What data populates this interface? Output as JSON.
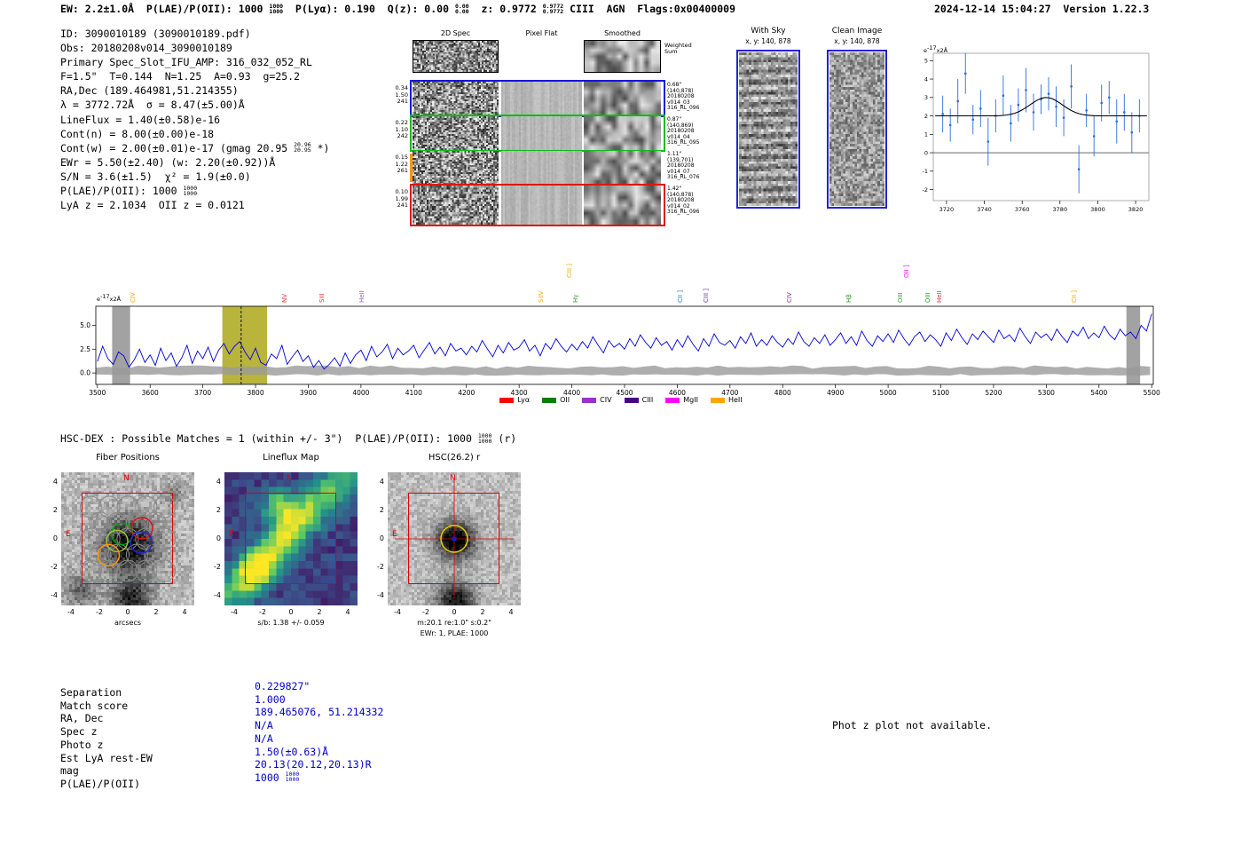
{
  "header": {
    "left_segments": [
      {
        "t": "EW: 2.2±1.0Å  P(LAE)/P(OII): 1000 ",
        "hi": "1000",
        "lo": "1000"
      },
      {
        "t": "  P(Lyα): 0.190  Q(z): 0.00 ",
        "hi": "0.00",
        "lo": "0.00"
      },
      {
        "t": "  z: 0.9772 ",
        "hi": "0.9772",
        "lo": "0.9772"
      },
      {
        "t": " CIII  AGN  Flags:0x00400009"
      }
    ],
    "datetime": "2024-12-14 15:04:27",
    "version": "Version 1.22.3"
  },
  "info_block": {
    "lines": [
      [
        {
          "t": "ID: 3090010189 (3090010189.pdf)"
        }
      ],
      [
        {
          "t": "Obs: 20180208v014_3090010189"
        }
      ],
      [
        {
          "t": "Primary Spec_Slot_IFU_AMP: 316_032_052_RL"
        }
      ],
      [
        {
          "t": "F=1.5\"  T=0.144  N=1.25  A=0.93  g=25.2"
        }
      ],
      [
        {
          "t": "RA,Dec (189.464981,51.214355)"
        }
      ],
      [
        {
          "t": "λ = 3772.72Å  σ = 8.47(±5.00)Å"
        }
      ],
      [
        {
          "t": "LineFlux = 1.40(±0.58)e-16"
        }
      ],
      [
        {
          "t": "Cont(n) = 8.00(±0.00)e-18"
        }
      ],
      [
        {
          "t": "Cont(w) = 2.00(±0.01)e-17 (gmag 20.95 ",
          "hi": "20.96",
          "lo": "20.95"
        },
        {
          "t": " *)"
        }
      ],
      [
        {
          "t": "EWr = 5.50(±2.40) (w: 2.20(±0.92))Å"
        }
      ],
      [
        {
          "t": "S/N = 3.6(±1.5)  χ² = 1.9(±0.0)"
        }
      ],
      [
        {
          "t": "P(LAE)/P(OII): 1000 ",
          "hi": "1000",
          "lo": "1000"
        }
      ],
      [
        {
          "t": "LyA z = 2.1034  OII z = 0.0121"
        }
      ]
    ]
  },
  "spec2d": {
    "col_headers": [
      "2D Spec",
      "Pixel Flat",
      "Smoothed"
    ],
    "weighted_sum": [
      "Weighted",
      "Sum"
    ],
    "rows": [
      {
        "left": [
          "0.34",
          "1.50",
          "241"
        ],
        "right": [
          "0.68\"",
          "(140,878)",
          "20180208",
          "v014_03",
          "316_RL_096"
        ],
        "border": "#1515e0"
      },
      {
        "left": [
          "0.22",
          "1.10",
          "242"
        ],
        "right": [
          "0.87\"",
          "(140,869)",
          "20180208",
          "v014_04",
          "316_RL_095"
        ],
        "border": "#11bb11"
      },
      {
        "left": [
          "0.15",
          "1.22",
          "261"
        ],
        "right": [
          "1.11\"",
          "(139,701)",
          "20180208",
          "v014_07",
          "316_RL_076"
        ],
        "border": "none",
        "left_tick": "#ff9900"
      },
      {
        "left": [
          "0.10",
          "1.99",
          "241"
        ],
        "right": [
          "1.42\"",
          "(140,878)",
          "20180208",
          "v014_02",
          "316_RL_096"
        ],
        "border": "#e01515"
      }
    ]
  },
  "sky_panels": [
    {
      "title": "With Sky",
      "subtitle": "x, y: 140, 878"
    },
    {
      "title": "Clean Image",
      "subtitle": "x, y: 140, 878"
    }
  ],
  "hsc_header": [
    {
      "t": "HSC-DEX : Possible Matches = 1 (within +/- 3\")  P(LAE)/P(OII): 1000 ",
      "hi": "1000",
      "lo": "1000"
    },
    {
      "t": " (r)"
    }
  ],
  "cutout_panels": {
    "titles": [
      "Fiber Positions",
      "Lineflux Map",
      "HSC(26.2) r"
    ],
    "xticks": [
      -4,
      -2,
      0,
      2,
      4
    ],
    "yticks": [
      4,
      2,
      0,
      -2,
      -4
    ],
    "xlabels": [
      "arcsecs",
      "s/b: 1.38 +/- 0.059",
      "m:20.1 re:1.0\" s:0.2\""
    ],
    "extra_label": "EWr: 1, PLAE: 1000",
    "compass_n": "N",
    "compass_e": "E",
    "accent_color": "#e00000"
  },
  "match_table": {
    "value_color": "#0000cd",
    "rows": [
      {
        "label": "Separation",
        "value": [
          {
            "t": "0.229827\""
          }
        ]
      },
      {
        "label": "Match score",
        "value": [
          {
            "t": "1.000"
          }
        ]
      },
      {
        "label": "RA, Dec",
        "value": [
          {
            "t": "189.465076, 51.214332"
          }
        ]
      },
      {
        "label": "Spec z",
        "value": [
          {
            "t": "N/A"
          }
        ]
      },
      {
        "label": "Photo z",
        "value": [
          {
            "t": "N/A"
          }
        ]
      },
      {
        "label": "Est LyA rest-EW",
        "value": [
          {
            "t": "1.50(±0.63)Å"
          }
        ]
      },
      {
        "label": "mag",
        "value": [
          {
            "t": "20.13(20.12,20.13)R"
          }
        ]
      },
      {
        "label": "P(LAE)/P(OII)",
        "value": [
          {
            "t": "1000 ",
            "hi": "1000",
            "lo": "1000"
          }
        ]
      }
    ]
  },
  "phot_z_note": "Phot z plot not available.",
  "chart_data": [
    {
      "id": "line_fit_plot",
      "type": "scatter",
      "annotation": [
        {
          "t": "e",
          "hi": "-17"
        },
        {
          "t": "x2Å"
        }
      ],
      "xlim": [
        3713,
        3827
      ],
      "ylim": [
        -2.6,
        5.4
      ],
      "xticks": [
        3720,
        3740,
        3760,
        3780,
        3800,
        3820
      ],
      "yticks": [
        5,
        4,
        3,
        2,
        1,
        0,
        -1,
        -2
      ],
      "points_x": [
        3718,
        3722,
        3726,
        3730,
        3734,
        3738,
        3742,
        3746,
        3750,
        3754,
        3758,
        3762,
        3766,
        3770,
        3774,
        3778,
        3782,
        3786,
        3790,
        3794,
        3798,
        3802,
        3806,
        3810,
        3814,
        3818,
        3822
      ],
      "points_y": [
        2.1,
        1.5,
        2.8,
        4.3,
        1.8,
        2.4,
        0.6,
        2.0,
        3.1,
        1.6,
        2.6,
        3.4,
        2.2,
        2.9,
        3.2,
        2.5,
        1.9,
        3.6,
        -0.9,
        2.3,
        0.9,
        2.7,
        3.0,
        1.7,
        2.2,
        1.1,
        2.0
      ],
      "points_yerr": [
        1.0,
        0.9,
        1.2,
        1.1,
        0.8,
        1.0,
        1.3,
        0.9,
        1.1,
        1.0,
        0.9,
        1.2,
        1.0,
        0.8,
        0.9,
        1.1,
        1.0,
        1.2,
        1.3,
        0.9,
        1.1,
        1.0,
        0.9,
        1.2,
        1.0,
        1.1,
        0.9
      ],
      "fit": {
        "shape": "gaussian",
        "center": 3772.72,
        "sigma": 8.47,
        "amplitude": 1.0,
        "continuum": 2.0
      },
      "point_color": "#2a6fdb",
      "fit_color": "#000000"
    },
    {
      "id": "full_spectrum",
      "type": "line",
      "ylabel": [
        {
          "t": "e",
          "hi": "-17"
        },
        {
          "t": "x2Å"
        }
      ],
      "xlim": [
        3497,
        5503
      ],
      "ylim": [
        -1.2,
        7.0
      ],
      "xticks": [
        3500,
        3600,
        3700,
        3800,
        3900,
        4000,
        4100,
        4200,
        4300,
        4400,
        4500,
        4600,
        4700,
        4800,
        4900,
        5000,
        5100,
        5200,
        5300,
        5400,
        5500
      ],
      "yticks": [
        "5.0",
        "2.5",
        "0.0"
      ],
      "ytick_values": [
        5.0,
        2.5,
        0.0
      ],
      "x_start": 3500,
      "x_step": 10,
      "values": [
        1.2,
        2.8,
        1.5,
        0.9,
        2.2,
        1.8,
        0.6,
        1.4,
        2.5,
        1.1,
        1.9,
        0.8,
        2.6,
        1.3,
        2.1,
        0.7,
        1.6,
        2.9,
        1.0,
        2.3,
        1.5,
        2.7,
        1.2,
        2.4,
        3.1,
        2.0,
        2.8,
        3.3,
        2.2,
        1.4,
        2.6,
        1.1,
        0.8,
        2.0,
        1.5,
        2.9,
        0.9,
        1.7,
        2.4,
        1.2,
        1.8,
        0.6,
        1.3,
        0.4,
        0.9,
        1.6,
        0.7,
        2.1,
        1.0,
        1.9,
        2.4,
        1.3,
        2.8,
        1.7,
        2.2,
        3.0,
        1.5,
        2.6,
        1.9,
        2.3,
        2.9,
        1.6,
        2.4,
        3.2,
        2.0,
        2.7,
        1.8,
        3.1,
        2.3,
        2.6,
        1.9,
        2.8,
        2.2,
        3.4,
        2.5,
        1.7,
        2.9,
        2.1,
        3.2,
        2.4,
        2.7,
        3.5,
        2.3,
        2.9,
        1.8,
        3.1,
        2.5,
        3.6,
        2.8,
        2.2,
        3.0,
        2.4,
        3.3,
        2.6,
        3.8,
        2.9,
        2.1,
        3.4,
        2.7,
        3.1,
        2.5,
        3.6,
        2.8,
        4.0,
        3.2,
        2.6,
        3.7,
        2.9,
        3.3,
        2.4,
        3.5,
        2.7,
        3.9,
        3.0,
        2.3,
        3.6,
        2.8,
        4.1,
        3.2,
        2.9,
        3.4,
        2.6,
        3.8,
        3.1,
        4.2,
        2.8,
        3.5,
        2.9,
        3.9,
        3.2,
        2.7,
        3.6,
        3.0,
        4.3,
        3.3,
        2.8,
        3.7,
        3.1,
        4.0,
        2.9,
        3.5,
        4.2,
        3.1,
        3.8,
        2.9,
        4.4,
        3.4,
        2.8,
        3.9,
        3.3,
        4.1,
        3.2,
        4.5,
        3.6,
        2.9,
        3.8,
        4.3,
        3.3,
        4.0,
        3.5,
        2.8,
        4.2,
        3.4,
        4.6,
        3.7,
        3.0,
        4.1,
        3.5,
        4.4,
        3.8,
        3.2,
        4.5,
        3.6,
        4.0,
        3.3,
        4.7,
        3.8,
        3.1,
        4.3,
        3.7,
        4.1,
        3.4,
        4.6,
        3.8,
        3.2,
        4.4,
        3.9,
        4.8,
        3.6,
        4.2,
        3.7,
        4.9,
        4.0,
        3.5,
        4.6,
        3.9,
        4.3,
        3.6,
        5.0,
        4.4,
        6.2
      ],
      "line_color": "#0000dd",
      "noise_band": {
        "high": 0.78,
        "low": -0.2,
        "color": "#9a9a9a"
      },
      "highlight_band": {
        "x0": 3737,
        "x1": 3822,
        "color": "#b9b43c"
      },
      "gray_bands": [
        {
          "x0": 3528,
          "x1": 3562
        },
        {
          "x0": 5452,
          "x1": 5478
        }
      ],
      "dashed_line_x": 3772.72,
      "line_markers": [
        {
          "label": "CIV",
          "wl": 3565,
          "color": "#ffa500"
        },
        {
          "label": "NV",
          "wl": 3852,
          "color": "#e03030"
        },
        {
          "label": "SiII",
          "wl": 3922,
          "color": "#e03030"
        },
        {
          "label": "HeII",
          "wl": 3998,
          "color": "#9467bd"
        },
        {
          "label": "SiIV",
          "wl": 4338,
          "color": "#ffa500"
        },
        {
          "label": "CIII ]",
          "wl": 4392,
          "color": "#ffa500",
          "tall": true
        },
        {
          "label": "Hγ",
          "wl": 4404,
          "color": "#2ca02c"
        },
        {
          "label": "CII ]",
          "wl": 4602,
          "color": "#1f77b4"
        },
        {
          "label": "CIII ]",
          "wl": 4652,
          "color": "#5e3c99"
        },
        {
          "label": "CIV",
          "wl": 4810,
          "color": "#7b2d8b"
        },
        {
          "label": "Hβ",
          "wl": 4922,
          "color": "#2ca02c"
        },
        {
          "label": "OIII",
          "wl": 5020,
          "color": "#2ca02c"
        },
        {
          "label": "OII ]",
          "wl": 5032,
          "color": "#ff00ff",
          "tall": true
        },
        {
          "label": "OIII",
          "wl": 5072,
          "color": "#2ca02c"
        },
        {
          "label": "HeII",
          "wl": 5094,
          "color": "#e03030"
        },
        {
          "label": "CII ]",
          "wl": 5350,
          "color": "#ffa500"
        }
      ],
      "legend": [
        {
          "label": "Lyα",
          "color": "#ff0000"
        },
        {
          "label": "OII",
          "color": "#008000"
        },
        {
          "label": "CIV",
          "color": "#9932cc"
        },
        {
          "label": "CIII",
          "color": "#4b0082"
        },
        {
          "label": "MgII",
          "color": "#ff00ff"
        },
        {
          "label": "HeII",
          "color": "#ffa500"
        }
      ]
    }
  ]
}
